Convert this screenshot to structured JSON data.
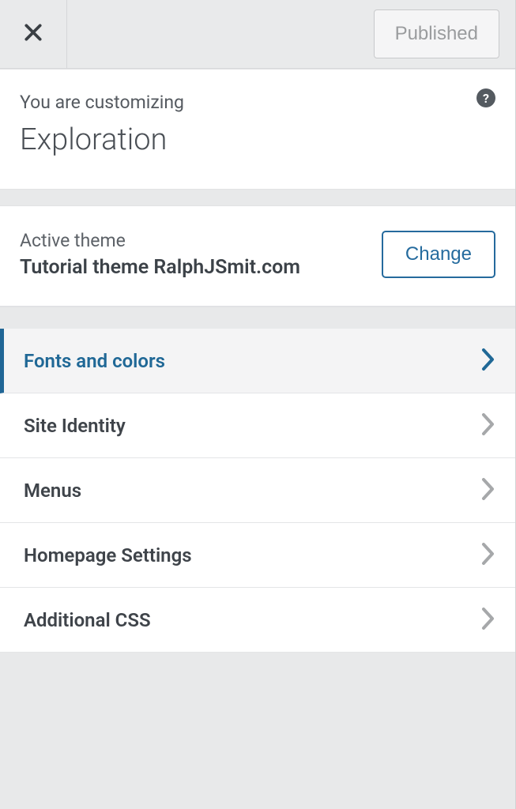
{
  "topbar": {
    "publish_status": "Published"
  },
  "header": {
    "subtitle": "You are customizing",
    "title": "Exploration",
    "help_glyph": "?"
  },
  "theme": {
    "label": "Active theme",
    "name": "Tutorial theme RalphJSmit.com",
    "change_label": "Change"
  },
  "menu": {
    "items": [
      {
        "label": "Fonts and colors",
        "active": true
      },
      {
        "label": "Site Identity",
        "active": false
      },
      {
        "label": "Menus",
        "active": false
      },
      {
        "label": "Homepage Settings",
        "active": false
      },
      {
        "label": "Additional CSS",
        "active": false
      }
    ]
  }
}
